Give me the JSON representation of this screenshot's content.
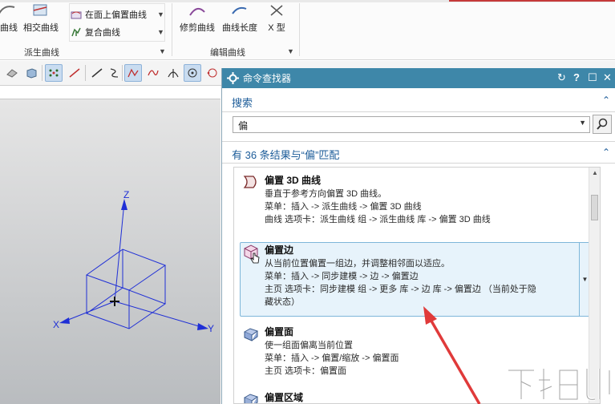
{
  "ribbon": {
    "btn_curve": "曲线",
    "btn_intersect": "相交曲线",
    "small_offset_face": "在面上偏置曲线",
    "small_composite": "复合曲线",
    "group_derived": "派生曲线",
    "btn_trim": "修剪曲线",
    "btn_length": "曲线长度",
    "btn_xtype": "X 型",
    "group_edit": "编辑曲线"
  },
  "axes": {
    "x": "X",
    "y": "Y",
    "z": "Z"
  },
  "dialog": {
    "title": "命令查找器",
    "search_header": "搜索",
    "search_value": "偏",
    "result_count": "有 36 条结果与“偏”匹配",
    "results": [
      {
        "title": "偏置 3D 曲线",
        "lines": [
          "垂直于参考方向偏置 3D 曲线。",
          "菜单：插入 -> 派生曲线 -> 偏置 3D 曲线",
          "曲线 选项卡：派生曲线 组 -> 派生曲线 库 -> 偏置 3D 曲线"
        ]
      },
      {
        "title": "偏置边",
        "lines": [
          "从当前位置偏置一组边，并调整相邻面以适应。",
          "菜单：插入 -> 同步建模 -> 边 -> 偏置边",
          "主页 选项卡：同步建模 组 -> 更多 库 -> 边 库 -> 偏置边 （当前处于隐",
          "藏状态）"
        ]
      },
      {
        "title": "偏置面",
        "lines": [
          "使一组面偏离当前位置",
          "菜单：插入 -> 偏置/缩放 -> 偏置面",
          "主页 选项卡：偏置面"
        ]
      },
      {
        "title": "偏置区域",
        "lines": []
      }
    ]
  },
  "colors": {
    "titlebar": "#3e87a9",
    "accent_text": "#1c5c99",
    "selection": "#e7f3fb",
    "annotation_arrow": "#e03a3a"
  }
}
